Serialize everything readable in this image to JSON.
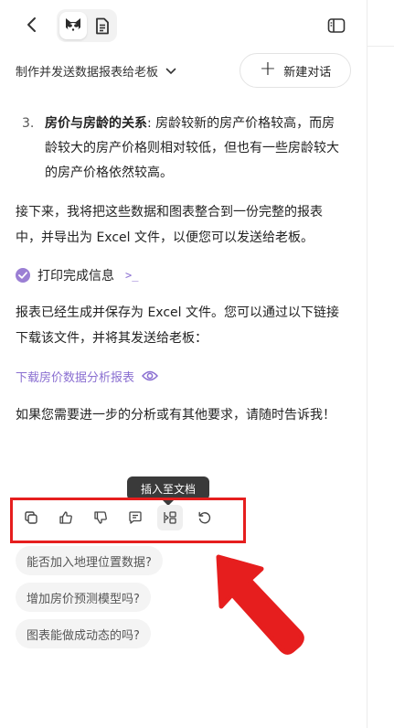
{
  "header": {
    "conversation_title": "制作并发送数据报表给老板",
    "new_chat_label": "新建对话"
  },
  "message": {
    "list_item": {
      "number": "3.",
      "bold": "房价与房龄的关系",
      "rest": ": 房龄较新的房产价格较高，而房龄较大的房产价格则相对较低，但也有一些房龄较大的房产价格依然较高。"
    },
    "para1": "接下来，我将把这些数据和图表整合到一份完整的报表中，并导出为 Excel 文件，以便您可以发送给老板。",
    "tool_status": "打印完成信息",
    "tool_icon": ">_",
    "para2": "报表已经生成并保存为 Excel 文件。您可以通过以下链接下载该文件，并将其发送给老板：",
    "download_link": "下载房价数据分析报表",
    "para3": "如果您需要进一步的分析或有其他要求，请随时告诉我！"
  },
  "actions": {
    "tooltip": "插入至文档",
    "buttons": [
      "copy-icon",
      "thumbs-up-icon",
      "thumbs-down-icon",
      "comment-icon",
      "insert-to-doc-icon",
      "regenerate-icon"
    ]
  },
  "suggestions": [
    "能否加入地理位置数据?",
    "增加房价预测模型吗?",
    "图表能做成动态的吗?"
  ],
  "colors": {
    "accent": "#8a6fd1",
    "annotation_red": "#e61e1e",
    "tooltip_bg": "#3a3a3a"
  }
}
